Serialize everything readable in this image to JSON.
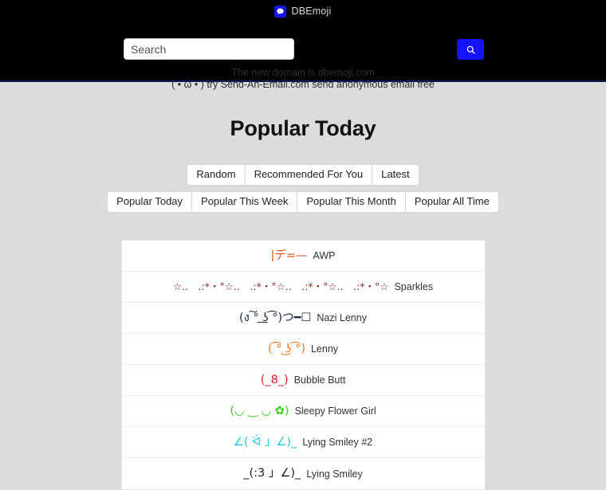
{
  "header": {
    "brand_name": "DBEmoji",
    "logo_icon": "speech-bubble-icon",
    "logo_color": "#1414ff",
    "search": {
      "placeholder": "Search",
      "value": "",
      "button_icon": "search-icon",
      "button_color": "#1414ff"
    },
    "notice_line1": "The new domain is dbemoji.com",
    "notice_line2": "( • ω • ) try Send-An-Email.com send anonymous email free"
  },
  "main": {
    "page_title": "Popular Today",
    "filter_row_1": [
      {
        "label": "Random"
      },
      {
        "label": "Recommended For You"
      },
      {
        "label": "Latest"
      }
    ],
    "filter_row_2": [
      {
        "label": "Popular Today"
      },
      {
        "label": "Popular This Week"
      },
      {
        "label": "Popular This Month"
      },
      {
        "label": "Popular All Time"
      }
    ],
    "emoji_rows": [
      {
        "art": "|デ=—",
        "label": "AWP",
        "color": "#d9480f",
        "size": "normal"
      },
      {
        "art": "☆..　.:*・°☆..　.:*・°☆..　.:*・°☆..　.:*・°☆",
        "label": "Sparkles",
        "color": "#8b2727",
        "size": "small"
      },
      {
        "art": "(ง ͠° ͟ʖ ͡°)つ━☐",
        "label": "Nazi Lenny",
        "color": "#1b2a4a",
        "size": "normal"
      },
      {
        "art": "( ͡° ͜ʖ ͡°)",
        "label": "Lenny",
        "color": "#f97316",
        "size": "normal"
      },
      {
        "art": "(_8_)",
        "label": "Bubble Butt",
        "color": "#e01b24",
        "size": "normal"
      },
      {
        "art": "(◡ ‿ ◡ ✿)",
        "label": "Sleepy Flower Girl",
        "color": "#2fd116",
        "size": "normal"
      },
      {
        "art": "∠( ᐛ 」∠)_",
        "label": "Lying Smiley #2",
        "color": "#1ecbe1",
        "size": "normal"
      },
      {
        "art": "_(:3 」∠)_",
        "label": "Lying Smiley",
        "color": "#222222",
        "size": "normal"
      }
    ]
  }
}
